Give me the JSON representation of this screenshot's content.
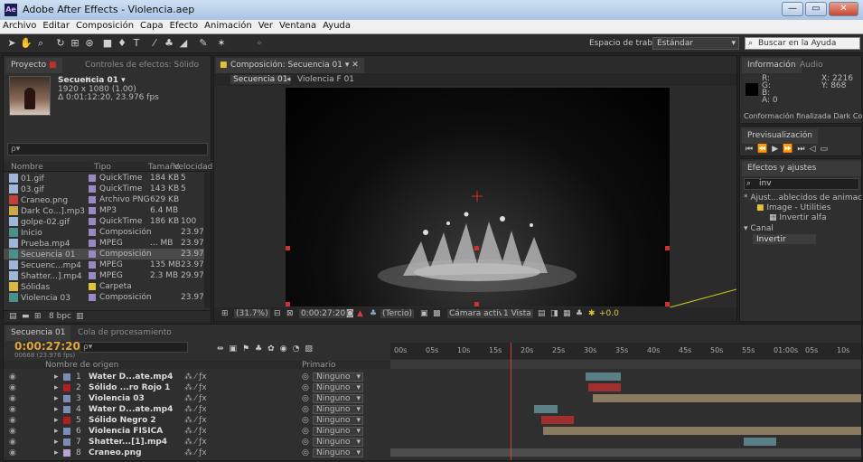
{
  "window": {
    "title": "Adobe After Effects - Violencia.aep",
    "app_badge": "Ae"
  },
  "menu": [
    "Archivo",
    "Editar",
    "Composición",
    "Capa",
    "Efecto",
    "Animación",
    "Ver",
    "Ventana",
    "Ayuda"
  ],
  "toolbar": {
    "workspace_label": "Espacio de trabajo:",
    "workspace_value": "Estándar",
    "help_placeholder": "Buscar en la Ayuda"
  },
  "project": {
    "tab": "Proyecto",
    "tab2": "Controles de efectos: Sólido Ne",
    "comp_name": "Secuencia 01 ▾",
    "comp_size": "1920 x 1080 (1.00)",
    "comp_dur": "Δ 0:01:12:20, 23.976 fps",
    "search_placeholder": "ρ▾",
    "columns": [
      "Nombre",
      "Tipo",
      "Tamaño",
      "Velocidad..."
    ],
    "items": [
      {
        "name": "01.gif",
        "type": "QuickTime",
        "size": "184 KB",
        "rate": "5",
        "color": "#9a8ac4",
        "icon": "#9fb6d8"
      },
      {
        "name": "03.gif",
        "type": "QuickTime",
        "size": "143 KB",
        "rate": "5",
        "color": "#9a8ac4",
        "icon": "#9fb6d8"
      },
      {
        "name": "Craneo.png",
        "type": "Archivo PNG",
        "size": "629 KB",
        "rate": "",
        "color": "#9a8ac4",
        "icon": "#c0413a"
      },
      {
        "name": "Dark Co...].mp3",
        "type": "MP3",
        "size": "6.4 MB",
        "rate": "",
        "color": "#9a8ac4",
        "icon": "#c8a84d"
      },
      {
        "name": "golpe-02.gif",
        "type": "QuickTime",
        "size": "186 KB",
        "rate": "100",
        "color": "#9a8ac4",
        "icon": "#9fb6d8"
      },
      {
        "name": "Inicio",
        "type": "Composición",
        "size": "",
        "rate": "23.976",
        "color": "#9a8ac4",
        "icon": "#4b8f8a"
      },
      {
        "name": "Prueba.mp4",
        "type": "MPEG",
        "size": "... MB",
        "rate": "23.976",
        "color": "#9a8ac4",
        "icon": "#9fb6d8"
      },
      {
        "name": "Secuencia 01",
        "type": "Composición",
        "size": "",
        "rate": "23.976",
        "color": "#9a8ac4",
        "icon": "#4b8f8a"
      },
      {
        "name": "Secuenc...mp4",
        "type": "MPEG",
        "size": "135 MB",
        "rate": "23.976",
        "color": "#9a8ac4",
        "icon": "#9fb6d8"
      },
      {
        "name": "Shatter...].mp4",
        "type": "MPEG",
        "size": "2.3 MB",
        "rate": "29.97",
        "color": "#9a8ac4",
        "icon": "#9fb6d8"
      },
      {
        "name": "Sólidas",
        "type": "Carpeta",
        "size": "",
        "rate": "",
        "color": "#e0c43a",
        "icon": "#d8b648"
      },
      {
        "name": "Violencia 03",
        "type": "Composición",
        "size": "",
        "rate": "23.976",
        "color": "#9a8ac4",
        "icon": "#4b8f8a"
      }
    ],
    "footer_bpc": "8 bpc"
  },
  "comp": {
    "tab": "Composición: Secuencia 01",
    "breadcrumbs": [
      "Secuencia 01",
      "Violencia F 01"
    ],
    "zoom": "(31.7%)",
    "timecode": "0:00:27:20",
    "resolution": "(Tercio)",
    "camera": "Cámara activa",
    "views": "1 Vista",
    "exposure": "+0.0"
  },
  "info": {
    "tab": "Información",
    "tab2": "Audio",
    "r": "R:",
    "g": "G:",
    "b": "B:",
    "a": "A: 0",
    "x": "X: 2216",
    "y": "Y: 868",
    "status": "Conformación finalizada Dark Countr"
  },
  "preview": {
    "tab": "Previsualización"
  },
  "effects": {
    "tab": "Efectos y ajustes preestableci",
    "search": "inv",
    "tree": [
      "* Ajust...ablecidos de animación",
      "Image - Utilities",
      "Invertir alfa",
      "Canal",
      "Invertir"
    ]
  },
  "timeline": {
    "tab": "Secuencia 01",
    "tab2": "Cola de procesamiento",
    "timecode": "0:00:27:20",
    "frames": "00668 (23.976 fps)",
    "col_src": "Nombre de origen",
    "col_parent": "Primario",
    "ruler": [
      "00s",
      "05s",
      "10s",
      "15s",
      "20s",
      "25s",
      "30s",
      "35s",
      "40s",
      "45s",
      "50s",
      "55s",
      "01:00s",
      "05s",
      "10s"
    ],
    "layers": [
      {
        "num": "1",
        "name": "Water D...ate.mp4",
        "color": "#7a8fb8",
        "parent": "Ninguno",
        "bar": {
          "start": 0.415,
          "end": 0.49,
          "color": "#5a7f86"
        }
      },
      {
        "num": "2",
        "name": "Sólido ...ro Rojo 1",
        "color": "#b02020",
        "parent": "Ninguno",
        "bar": {
          "start": 0.42,
          "end": 0.49,
          "color": "#a03030"
        }
      },
      {
        "num": "3",
        "name": "Violencia 03",
        "color": "#7a8fb8",
        "parent": "Ninguno",
        "bar": {
          "start": 0.43,
          "end": 1.0,
          "color": "#8a7a60"
        }
      },
      {
        "num": "4",
        "name": "Water D...ate.mp4",
        "color": "#7a8fb8",
        "parent": "Ninguno",
        "bar": {
          "start": 0.305,
          "end": 0.355,
          "color": "#5a7f86"
        }
      },
      {
        "num": "5",
        "name": "Sólido Negro 2",
        "color": "#b02020",
        "parent": "Ninguno",
        "bar": {
          "start": 0.32,
          "end": 0.39,
          "color": "#a03030"
        }
      },
      {
        "num": "6",
        "name": "Violencia FISICA",
        "color": "#7a8fb8",
        "parent": "Ninguno",
        "bar": {
          "start": 0.325,
          "end": 1.0,
          "color": "#8a7a60"
        }
      },
      {
        "num": "7",
        "name": "Shatter...[1].mp4",
        "color": "#7a8fb8",
        "parent": "Ninguno",
        "bar": {
          "start": 0.75,
          "end": 0.82,
          "color": "#5a7f86"
        }
      },
      {
        "num": "8",
        "name": "Craneo.png",
        "color": "#b9a3d6",
        "parent": "Ninguno",
        "bar": {
          "start": 0.0,
          "end": 1.0,
          "color": "#4d4d4d"
        }
      }
    ],
    "playhead_frac": 0.255
  }
}
